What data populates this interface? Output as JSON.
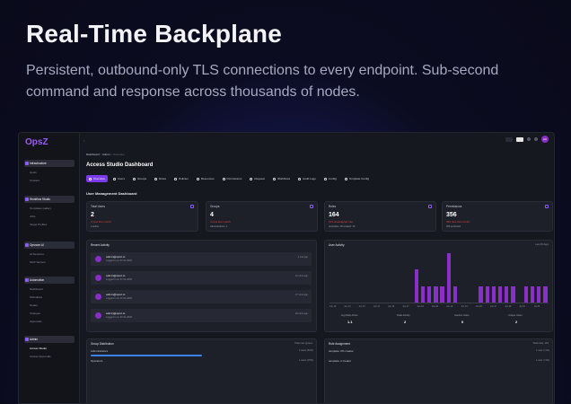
{
  "hero": {
    "title": "Real-Time Backplane",
    "subtitle": "Persistent, outbound-only TLS connections to every endpoint. Sub-second command and response across thousands of nodes."
  },
  "app": {
    "logo": "OpsZ",
    "sidebar": {
      "sections": [
        {
          "label": "Infrastructure",
          "items": [
            "Infrastructure",
            "Hosts",
            "Clusters"
          ]
        },
        {
          "label": "Workflow Studio",
          "items": [
            "Workflow Studio",
            "Templates Gallery",
            "Jobs",
            "Target Profiles"
          ]
        },
        {
          "label": "Automation",
          "items": [
            "Opsnom AI",
            "AI Sessions",
            "MCP Servers"
          ]
        },
        {
          "label": "Management",
          "items": [
            "Automation",
            "Dashboard",
            "Schedules",
            "Nodes",
            "Changes",
            "Approvals"
          ]
        },
        {
          "label": "Administration",
          "items": [
            "Admin",
            "Access Studio",
            "Access Approvals"
          ]
        }
      ]
    },
    "topbar": {
      "avatar_initials": "AU",
      "user_label": "Admin"
    },
    "breadcrumb": {
      "first": "Dashboard",
      "sep1": ">",
      "second": "Admin",
      "sep2": ">",
      "third": "Overview"
    },
    "page_title": "Access Studio Dashboard",
    "tabs": [
      "Overview",
      "Users",
      "Groups",
      "Roles",
      "Policies",
      "Resources",
      "Permissions",
      "Request",
      "Workflows",
      "Audit Logs",
      "Config",
      "Template Config"
    ],
    "section_title": "User Management Dashboard",
    "stats": [
      {
        "label": "Total Users",
        "value": "2",
        "delta": "2 new this month",
        "foot": "2 active"
      },
      {
        "label": "Groups",
        "value": "4",
        "delta": "4 new this month",
        "foot": "Administrators: 1"
      },
      {
        "label": "Roles",
        "value": "164",
        "delta": "164 unassigned role",
        "foot": "templates: 28 created: 15"
      },
      {
        "label": "Permissions",
        "value": "356",
        "delta": "356 new this month",
        "foot": "356 protected"
      }
    ],
    "recent_activity": {
      "title": "Recent Activity",
      "rows": [
        {
          "user": "admin@opsz.io",
          "desc": "Logged in on 07-01-2026",
          "time": "1 min ago"
        },
        {
          "user": "admin@opsz.io",
          "desc": "Logged in on 07-01-2026",
          "time": "12 mins ago"
        },
        {
          "user": "admin@opsz.io",
          "desc": "Logged in on 07-01-2026",
          "time": "17 mins ago"
        },
        {
          "user": "admin@opsz.io",
          "desc": "Logged in on 07-01-2026",
          "time": "20 mins ago"
        }
      ]
    },
    "user_activity": {
      "title": "User Activity",
      "filter": "Last 30 days",
      "chart_data": {
        "type": "bar",
        "categories": [
          "Jun 09",
          "Jun 10",
          "Jun 11",
          "Jun 12",
          "Jun 13",
          "Jun 14",
          "Jun 15",
          "Jun 16",
          "Jun 17",
          "Jun 18",
          "Jun 19",
          "Jun 20",
          "Jun 21",
          "Jun 22",
          "Jun 23",
          "Jun 24",
          "Jun 25",
          "Jun 26",
          "Jun 27",
          "Jun 28",
          "Jun 29",
          "Jun 30",
          "Jul 01",
          "Jul 02",
          "Jul 03",
          "Jul 04",
          "Jul 05"
        ],
        "tick_labels": [
          "Jun 10",
          "Jun 12",
          "Jun 13",
          "Jun 14",
          "Jun 16",
          "Jun 17",
          "Jun 19",
          "Jun 20",
          "Jun 22",
          "Jun 24",
          "Jun 26",
          "Jun 27",
          "Jun 29",
          "Jul 01",
          "Jul 03"
        ],
        "values": [
          0,
          0,
          0,
          0,
          0,
          0,
          0,
          0,
          0,
          0,
          0,
          0,
          0,
          2,
          1,
          1,
          1,
          1,
          3,
          1,
          0,
          0,
          0,
          1,
          1,
          1,
          1,
          1,
          1,
          0,
          1,
          1,
          1,
          1
        ],
        "ylim": [
          0,
          3
        ]
      },
      "footer": [
        {
          "label": "Avg Daily Active",
          "value": "1.1"
        },
        {
          "label": "Peak Activity",
          "value": "2"
        },
        {
          "label": "Inactive Users",
          "value": "0"
        },
        {
          "label": "Unique Users",
          "value": "2"
        }
      ]
    },
    "group_distribution": {
      "title": "Group Distribution",
      "filter": "Total user groups",
      "rows": [
        {
          "label": "Administrators",
          "value": "2 users (50%)",
          "fraction": 0.5
        },
        {
          "label": "Operators",
          "value": "1 users (25%)",
          "fraction": 0.25
        }
      ]
    },
    "role_assignment": {
      "title": "Role Assignment",
      "filter": "Total roles: 164",
      "rows": [
        {
          "label": "template: 0% creator",
          "value": "1 user (<1%)"
        },
        {
          "label": "template: 2 creator",
          "value": "1 user (<1%)"
        }
      ]
    }
  }
}
